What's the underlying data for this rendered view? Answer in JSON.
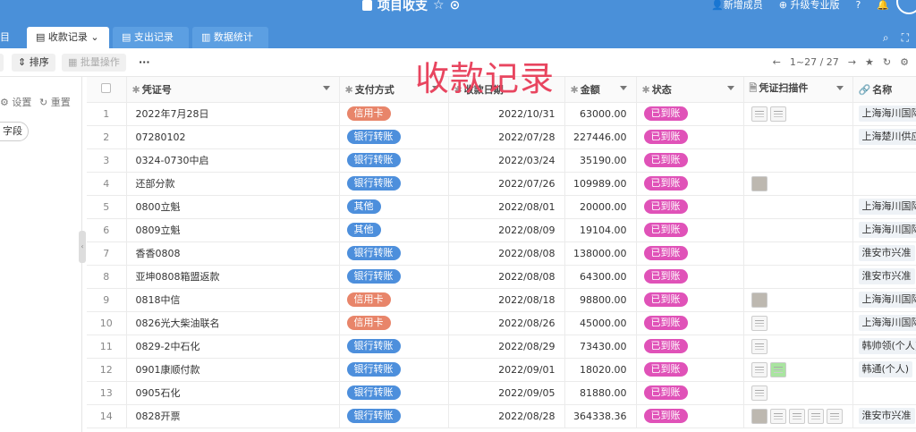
{
  "header": {
    "title": "项目收支",
    "new_member": "新增成员",
    "upgrade": "升级专业版",
    "help": "?"
  },
  "tabs": [
    {
      "label": "目"
    },
    {
      "label": "收款记录"
    },
    {
      "label": "支出记录"
    },
    {
      "label": "数据统计"
    }
  ],
  "toolbar": {
    "sort_label": "排序",
    "batch_label": "批量操作",
    "more_label": "···",
    "pager": "1~27 / 27"
  },
  "left_panel": {
    "settings": "设置",
    "reset": "重置",
    "field": "字段"
  },
  "overlay_text": "收款记录",
  "columns": [
    "凭证号",
    "支付方式",
    "收款日期",
    "金额",
    "状态",
    "凭证扫描件",
    "名称"
  ],
  "colors": {
    "credit": "#e8856a",
    "bank": "#4d8fdc",
    "other": "#4d8fdc",
    "status": "#e052b8"
  },
  "rows": [
    {
      "n": "1",
      "voucher": "2022年7月28日",
      "method": "信用卡",
      "mtype": "credit",
      "date": "2022/10/31",
      "amount": "63000.00",
      "status": "已到账",
      "scans": [
        "doc",
        "doc"
      ],
      "name": "上海海川国际"
    },
    {
      "n": "2",
      "voucher": "07280102",
      "method": "银行转账",
      "mtype": "bank",
      "date": "2022/07/28",
      "amount": "227446.00",
      "status": "已到账",
      "scans": [],
      "name": "上海楚川供应"
    },
    {
      "n": "3",
      "voucher": "0324-0730中启",
      "method": "银行转账",
      "mtype": "bank",
      "date": "2022/03/24",
      "amount": "35190.00",
      "status": "已到账",
      "scans": [],
      "name": ""
    },
    {
      "n": "4",
      "voucher": "还部分款",
      "method": "银行转账",
      "mtype": "bank",
      "date": "2022/07/26",
      "amount": "109989.00",
      "status": "已到账",
      "scans": [
        "photo"
      ],
      "name": ""
    },
    {
      "n": "5",
      "voucher": "0800立魁",
      "method": "其他",
      "mtype": "other",
      "date": "2022/08/01",
      "amount": "20000.00",
      "status": "已到账",
      "scans": [],
      "name": "上海海川国际"
    },
    {
      "n": "6",
      "voucher": "0809立魁",
      "method": "其他",
      "mtype": "other",
      "date": "2022/08/09",
      "amount": "19104.00",
      "status": "已到账",
      "scans": [],
      "name": "上海海川国际"
    },
    {
      "n": "7",
      "voucher": "香香0808",
      "method": "银行转账",
      "mtype": "bank",
      "date": "2022/08/08",
      "amount": "138000.00",
      "status": "已到账",
      "scans": [],
      "name": "淮安市兴准"
    },
    {
      "n": "8",
      "voucher": "亚坤0808箱盟返款",
      "method": "银行转账",
      "mtype": "bank",
      "date": "2022/08/08",
      "amount": "64300.00",
      "status": "已到账",
      "scans": [],
      "name": "淮安市兴准"
    },
    {
      "n": "9",
      "voucher": "0818中信",
      "method": "信用卡",
      "mtype": "credit",
      "date": "2022/08/18",
      "amount": "98800.00",
      "status": "已到账",
      "scans": [
        "photo"
      ],
      "name": "上海海川国际"
    },
    {
      "n": "10",
      "voucher": "0826光大柴油联名",
      "method": "信用卡",
      "mtype": "credit",
      "date": "2022/08/26",
      "amount": "45000.00",
      "status": "已到账",
      "scans": [
        "doc"
      ],
      "name": "上海海川国际"
    },
    {
      "n": "11",
      "voucher": "0829-2中石化",
      "method": "银行转账",
      "mtype": "bank",
      "date": "2022/08/29",
      "amount": "73430.00",
      "status": "已到账",
      "scans": [
        "doc"
      ],
      "name": "韩帅领(个人)"
    },
    {
      "n": "12",
      "voucher": "0901康顺付款",
      "method": "银行转账",
      "mtype": "bank",
      "date": "2022/09/01",
      "amount": "18020.00",
      "status": "已到账",
      "scans": [
        "doc",
        "green"
      ],
      "name": "韩通(个人)"
    },
    {
      "n": "13",
      "voucher": "0905石化",
      "method": "银行转账",
      "mtype": "bank",
      "date": "2022/09/05",
      "amount": "81880.00",
      "status": "已到账",
      "scans": [
        "doc"
      ],
      "name": ""
    },
    {
      "n": "14",
      "voucher": "0828开票",
      "method": "银行转账",
      "mtype": "bank",
      "date": "2022/08/28",
      "amount": "364338.36",
      "status": "已到账",
      "scans": [
        "photo",
        "doc",
        "doc",
        "doc",
        "doc"
      ],
      "name": "淮安市兴准"
    }
  ]
}
